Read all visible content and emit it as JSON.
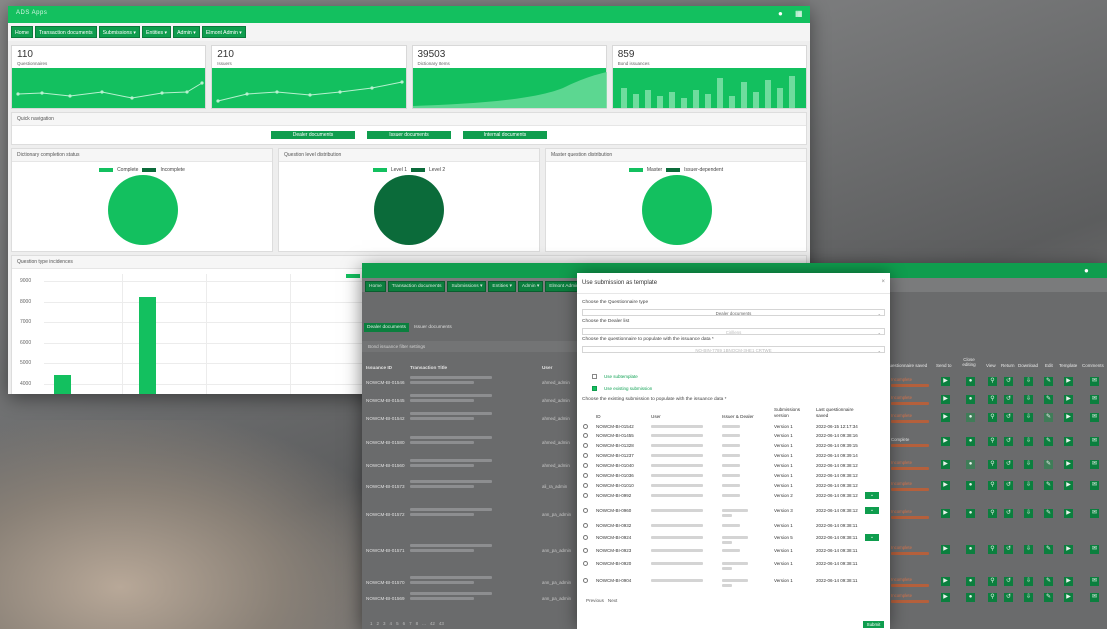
{
  "window1": {
    "logo": "ADS Apps",
    "nav": [
      "Home",
      "Transaction documents",
      "Submissions ▾",
      "Entities ▾",
      "Admin ▾",
      "Elmont Admin ▾"
    ],
    "cards": [
      {
        "value": "110",
        "label": "Questionnaires"
      },
      {
        "value": "210",
        "label": "Issuers"
      },
      {
        "value": "39503",
        "label": "Dictionary Items"
      },
      {
        "value": "859",
        "label": "Bond issuances"
      }
    ],
    "quick_nav": {
      "title": "Quick navigation",
      "buttons": [
        "Dealer documents",
        "Issuer documents",
        "Internal documents"
      ]
    },
    "pies": [
      {
        "title": "Dictionary completion status",
        "legend": [
          "Complete",
          "Incomplete"
        ],
        "colors": [
          "#13c05f",
          "#0b6b3a"
        ],
        "fill": "#13c05f"
      },
      {
        "title": "Question level distribution",
        "legend": [
          "Level 1",
          "Level 2"
        ],
        "colors": [
          "#13c05f",
          "#0b6b3a"
        ],
        "fill": "#0b6b3a"
      },
      {
        "title": "Master question distribution",
        "legend": [
          "Master",
          "Issuer-dependent"
        ],
        "colors": [
          "#13c05f",
          "#0b6b3a"
        ],
        "fill": "#13c05f"
      }
    ],
    "bar_chart": {
      "title": "Question type incidences",
      "legend": "Ma",
      "yticks": [
        "9000",
        "8000",
        "7000",
        "6000",
        "5000",
        "4000"
      ]
    }
  },
  "chart_data": {
    "type": "bar",
    "title": "Question type incidences",
    "ylim": [
      3000,
      9000
    ],
    "values": [
      4400,
      8200
    ]
  },
  "window2": {
    "nav": [
      "Home",
      "Transaction documents",
      "Submissions ▾",
      "Entities ▾",
      "Admin ▾",
      "Elmont Admin ▾"
    ],
    "tabs": [
      "Dealer documents",
      "Issuer documents"
    ],
    "subhead": "Bond issuance filter settings",
    "headers": {
      "id": "Issuance ID",
      "title": "Transaction Title",
      "user": "User"
    },
    "right_headers": [
      "questionnaire saved",
      "Send to",
      "Close editing",
      "View",
      "Return",
      "Download",
      "Edit",
      "Template",
      "Comments"
    ],
    "rows": [
      {
        "id": "NOWCM-BI-01546",
        "user": "ahmed_admin",
        "status": "Incomplete"
      },
      {
        "id": "NOWCM-BI-01545",
        "user": "ahmed_admin",
        "status": "Incomplete"
      },
      {
        "id": "NOWCM-BI-01542",
        "user": "ahmed_admin",
        "status": "Incomplete"
      },
      {
        "id": "NOWCM-BI-01580",
        "user": "ahmed_admin",
        "status": "Complete"
      },
      {
        "id": "NOWCM-BI-01560",
        "user": "ahmed_admin",
        "status": "Incomplete"
      },
      {
        "id": "NOWCM-BI-01573",
        "user": "ali_ra_admin",
        "status": "Incomplete"
      },
      {
        "id": "NOWCM-BI-01572",
        "user": "ann_pa_admin",
        "status": "Incomplete"
      },
      {
        "id": "NOWCM-BI-01571",
        "user": "ann_pa_admin",
        "status": "Incomplete"
      },
      {
        "id": "NOWCM-BI-01570",
        "user": "ann_pa_admin",
        "status": "Incomplete"
      },
      {
        "id": "NOWCM-BI-01569",
        "user": "ann_pa_admin",
        "status": "Incomplete"
      }
    ],
    "pager": [
      "1",
      "2",
      "3",
      "4",
      "5",
      "6",
      "7",
      "8",
      "...",
      "42",
      "43"
    ]
  },
  "modal": {
    "title": "Use submission as template",
    "close": "×",
    "label_questionnaire_type": "Choose the Questionnaire type",
    "questionnaire_type": "Dealer documents",
    "label_dealer": "Choose the Dealer list",
    "dealer": "Cirillens",
    "label_issuance": "Choose the questionnaire to populate with the issuance data *",
    "issuance": "NO-BIN-7789 1BNOCM-3HE1 CRTWE",
    "use_subtemplate": "Use subtemplate",
    "use_existing": "Use existing submission",
    "label_existing": "Choose the existing submission to populate with the issuance data *",
    "columns": {
      "id": "ID",
      "user": "User",
      "issuer": "Issuer & Dealer",
      "version": "Submissions version",
      "saved": "Last questionnaire saved"
    },
    "rows": [
      {
        "id": "NOWCM-BI-01542",
        "version": "Version 1",
        "saved": "2022-06-15 12:17:34"
      },
      {
        "id": "NOWCM-BI-01455",
        "version": "Version 1",
        "saved": "2022-06-14 09:38:16"
      },
      {
        "id": "NOWCM-BI-01328",
        "version": "Version 1",
        "saved": "2022-06-14 09:39:15"
      },
      {
        "id": "NOWCM-BI-01237",
        "version": "Version 1",
        "saved": "2022-06-14 09:39:14"
      },
      {
        "id": "NOWCM-BI-01040",
        "version": "Version 1",
        "saved": "2022-06-14 09:38:12"
      },
      {
        "id": "NOWCM-BI-01036",
        "version": "Version 1",
        "saved": "2022-06-14 09:38:12"
      },
      {
        "id": "NOWCM-BI-01010",
        "version": "Version 1",
        "saved": "2022-06-14 09:38:12"
      },
      {
        "id": "NOWCM-BI-0992",
        "version": "Version 2",
        "saved": "2022-06-14 09:38:12"
      },
      {
        "id": "NOWCM-BI-0960",
        "version": "Version 3",
        "saved": "2022-06-14 09:38:12"
      },
      {
        "id": "NOWCM-BI-0932",
        "version": "Version 1",
        "saved": "2022-06-14 09:38:11"
      },
      {
        "id": "NOWCM-BI-0924",
        "version": "Version 5",
        "saved": "2022-06-14 09:38:11"
      },
      {
        "id": "NOWCM-BI-0923",
        "version": "Version 1",
        "saved": "2022-06-14 09:38:11"
      },
      {
        "id": "NOWCM-BI-0920",
        "version": "Version 1",
        "saved": "2022-06-14 09:38:11"
      },
      {
        "id": "NOWCM-BI-0904",
        "version": "Version 1",
        "saved": "2022-06-14 09:38:11"
      }
    ],
    "previous": "Previous",
    "next": "Next",
    "submit": "Submit"
  }
}
